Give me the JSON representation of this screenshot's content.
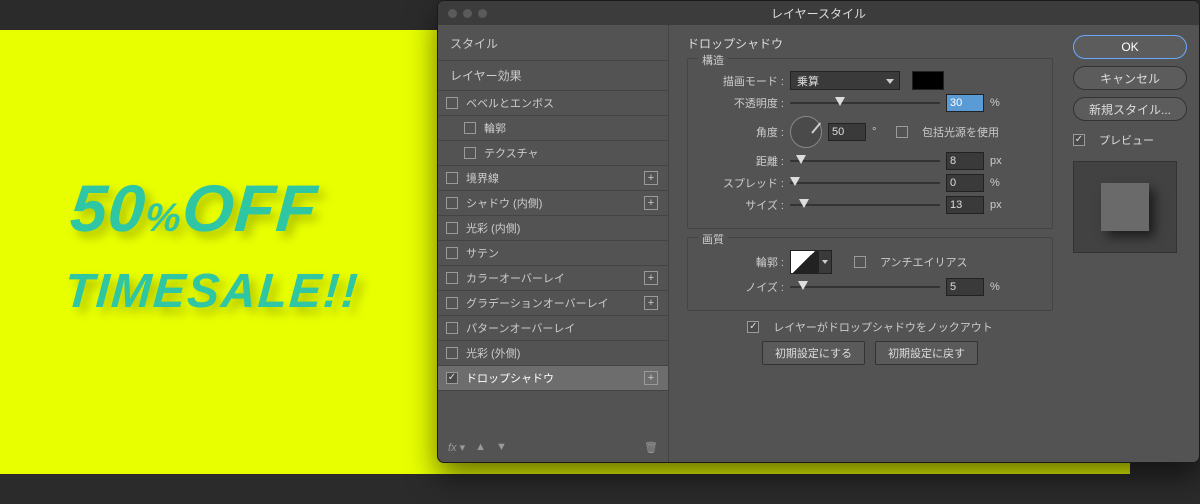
{
  "bg_sale": {
    "line1_prefix": "50",
    "line1_mid": "%",
    "line1_suffix": "OFF",
    "line2": "TIMESALE!!"
  },
  "dialog": {
    "title": "レイヤースタイル",
    "sidebar": {
      "styles_label": "スタイル",
      "effects_label": "レイヤー効果",
      "items": [
        {
          "label": "ベベルとエンボス",
          "checked": false,
          "has_add": false,
          "indent": false
        },
        {
          "label": "輪郭",
          "checked": false,
          "has_add": false,
          "indent": true
        },
        {
          "label": "テクスチャ",
          "checked": false,
          "has_add": false,
          "indent": true
        },
        {
          "label": "境界線",
          "checked": false,
          "has_add": true,
          "indent": false
        },
        {
          "label": "シャドウ (内側)",
          "checked": false,
          "has_add": true,
          "indent": false
        },
        {
          "label": "光彩 (内側)",
          "checked": false,
          "has_add": false,
          "indent": false
        },
        {
          "label": "サテン",
          "checked": false,
          "has_add": false,
          "indent": false
        },
        {
          "label": "カラーオーバーレイ",
          "checked": false,
          "has_add": true,
          "indent": false
        },
        {
          "label": "グラデーションオーバーレイ",
          "checked": false,
          "has_add": true,
          "indent": false
        },
        {
          "label": "パターンオーバーレイ",
          "checked": false,
          "has_add": false,
          "indent": false
        },
        {
          "label": "光彩 (外側)",
          "checked": false,
          "has_add": false,
          "indent": false
        },
        {
          "label": "ドロップシャドウ",
          "checked": true,
          "has_add": true,
          "indent": false,
          "active": true
        }
      ],
      "footer_fx": "fx"
    },
    "panel": {
      "title": "ドロップシャドウ",
      "structure": {
        "legend": "構造",
        "blend_label": "描画モード :",
        "blend_value": "乗算",
        "opacity_label": "不透明度 :",
        "opacity_value": "30",
        "opacity_unit": "%",
        "angle_label": "角度 :",
        "angle_value": "50",
        "angle_unit": "°",
        "global_light_label": "包括光源を使用",
        "distance_label": "距離 :",
        "distance_value": "8",
        "distance_unit": "px",
        "spread_label": "スプレッド :",
        "spread_value": "0",
        "spread_unit": "%",
        "size_label": "サイズ :",
        "size_value": "13",
        "size_unit": "px"
      },
      "quality": {
        "legend": "画質",
        "contour_label": "輪郭 :",
        "antialias_label": "アンチエイリアス",
        "noise_label": "ノイズ :",
        "noise_value": "5",
        "noise_unit": "%"
      },
      "knockout_label": "レイヤーがドロップシャドウをノックアウト",
      "make_default": "初期設定にする",
      "reset_default": "初期設定に戻す"
    },
    "right": {
      "ok": "OK",
      "cancel": "キャンセル",
      "new_style": "新規スタイル...",
      "preview_label": "プレビュー"
    }
  }
}
